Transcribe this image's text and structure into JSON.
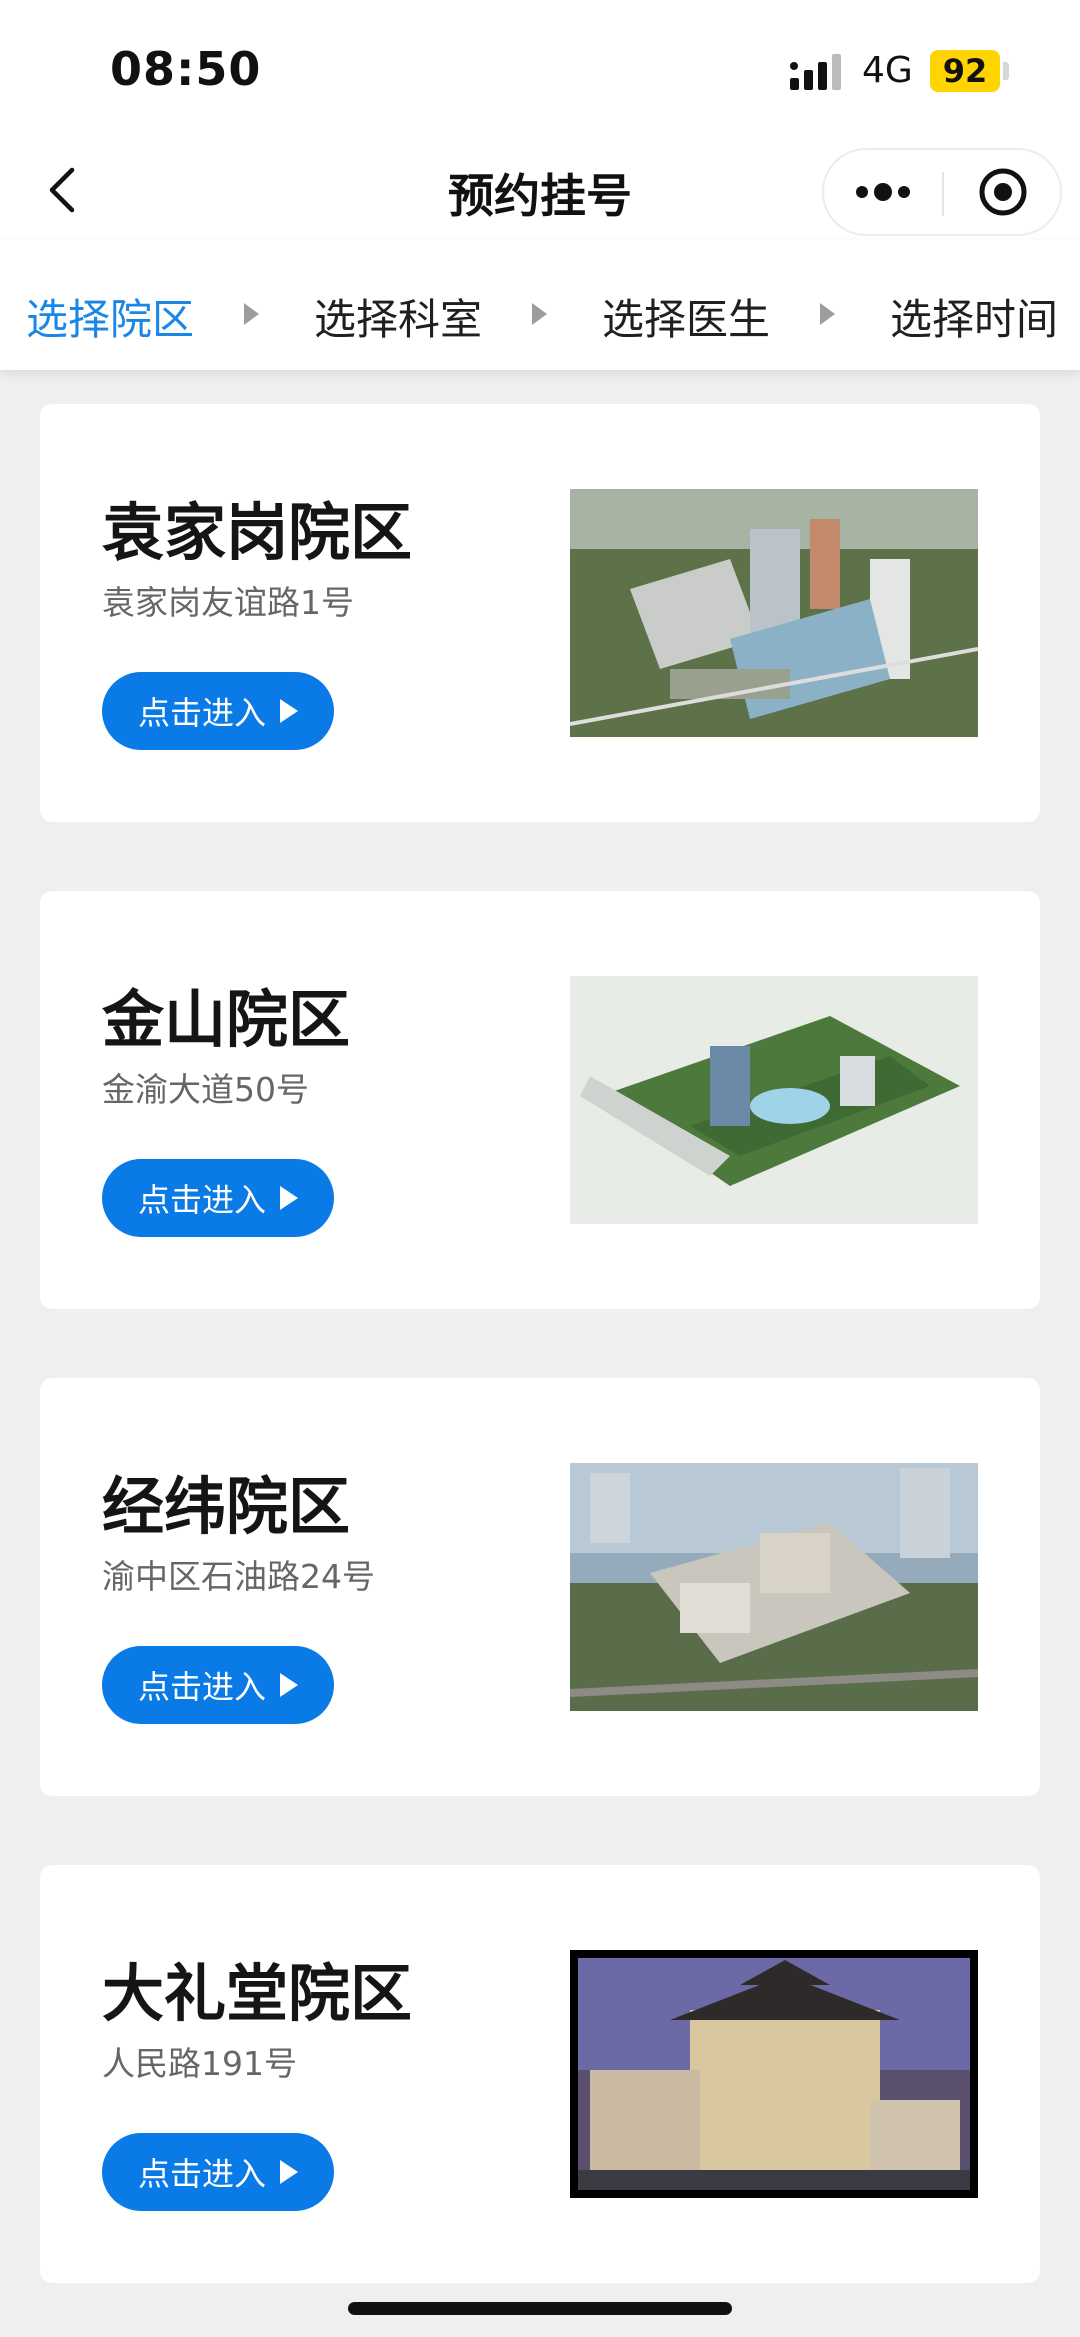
{
  "status": {
    "time": "08:50",
    "network": "4G",
    "battery": "92"
  },
  "nav": {
    "title": "预约挂号"
  },
  "steps": [
    {
      "label": "选择院区",
      "active": true
    },
    {
      "label": "选择科室",
      "active": false
    },
    {
      "label": "选择医生",
      "active": false
    },
    {
      "label": "选择时间",
      "active": false
    }
  ],
  "campuses": [
    {
      "name": "袁家岗院区",
      "address": "袁家岗友谊路1号",
      "button": "点击进入",
      "image": "hospital-aerial-photo"
    },
    {
      "name": "金山院区",
      "address": "金渝大道50号",
      "button": "点击进入",
      "image": "hospital-rendering-photo"
    },
    {
      "name": "经纬院区",
      "address": "渝中区石油路24号",
      "button": "点击进入",
      "image": "hospital-aerial-photo"
    },
    {
      "name": "大礼堂院区",
      "address": "人民路191号",
      "button": "点击进入",
      "image": "hospital-night-photo"
    }
  ],
  "colors": {
    "accent": "#1a86e6",
    "button": "#0a7ae6",
    "background": "#efefef",
    "battery": "#ffd400"
  }
}
